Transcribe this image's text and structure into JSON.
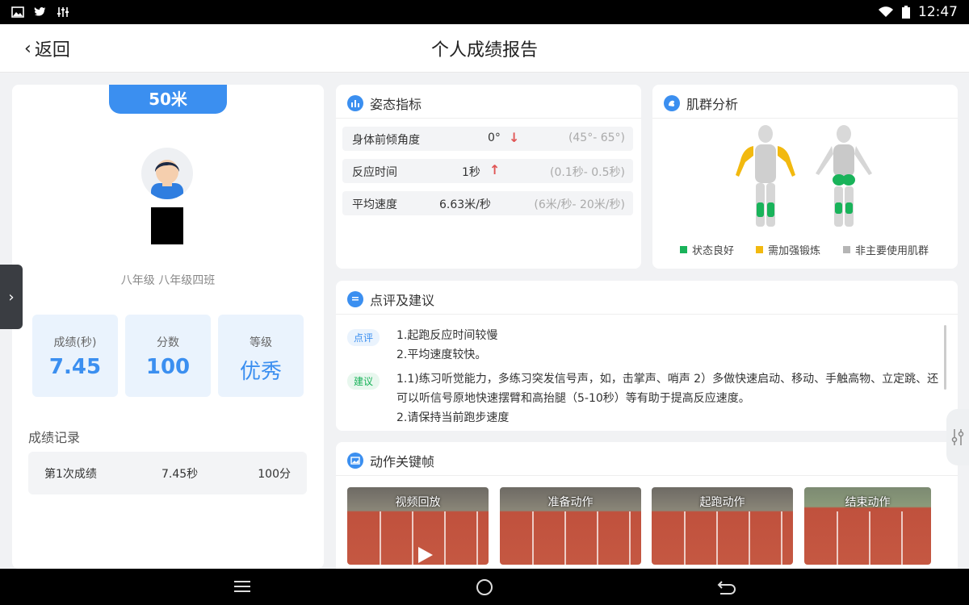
{
  "status_bar": {
    "time": "12:47",
    "icons": [
      "image-icon",
      "twitter-icon",
      "equalizer-icon",
      "wifi-icon",
      "battery-icon"
    ]
  },
  "header": {
    "back_label": "返回",
    "title": "个人成绩报告"
  },
  "profile": {
    "event_tab": "50米",
    "class_name": "八年级 八年级四班",
    "stats": [
      {
        "label": "成绩(秒)",
        "value": "7.45"
      },
      {
        "label": "分数",
        "value": "100"
      },
      {
        "label": "等级",
        "value": "优秀"
      }
    ],
    "records_title": "成绩记录",
    "records": [
      {
        "name": "第1次成绩",
        "time": "7.45秒",
        "score": "100分"
      }
    ]
  },
  "posture": {
    "title": "姿态指标",
    "rows": [
      {
        "label": "身体前倾角度",
        "value": "0°",
        "trend": "down",
        "arrow": "↓",
        "range": "(45°- 65°)"
      },
      {
        "label": "反应时间",
        "value": "1秒",
        "trend": "up",
        "arrow": "↑",
        "range": "(0.1秒- 0.5秒)"
      },
      {
        "label": "平均速度",
        "value": "6.63米/秒",
        "trend": "",
        "arrow": "",
        "range": "(6米/秒- 20米/秒)"
      }
    ]
  },
  "muscle": {
    "title": "肌群分析",
    "legend": [
      {
        "label": "状态良好",
        "color": "#19b35a"
      },
      {
        "label": "需加强锻炼",
        "color": "#f2b90f"
      },
      {
        "label": "非主要使用肌群",
        "color": "#b5b5b5"
      }
    ]
  },
  "comments": {
    "title": "点评及建议",
    "review_tag": "点评",
    "review_lines": [
      "1.起跑反应时间较慢",
      "2.平均速度较快。"
    ],
    "advice_tag": "建议",
    "advice_lines": [
      "1.1)练习听觉能力，多练习突发信号声，如，击掌声、哨声 2）多做快速启动、移动、手触高物、立定跳、还可以听信号原地快速摆臂和高抬腿（5-10秒）等有助于提高反应速度。",
      "2.请保持当前跑步速度"
    ]
  },
  "keyframes": {
    "title": "动作关键帧",
    "frames": [
      {
        "label": "视频回放"
      },
      {
        "label": "准备动作"
      },
      {
        "label": "起跑动作"
      },
      {
        "label": "结束动作"
      }
    ]
  },
  "colors": {
    "accent": "#3b8ff0",
    "good": "#19b35a",
    "warn": "#f2b90f",
    "arrow": "#e05555"
  }
}
